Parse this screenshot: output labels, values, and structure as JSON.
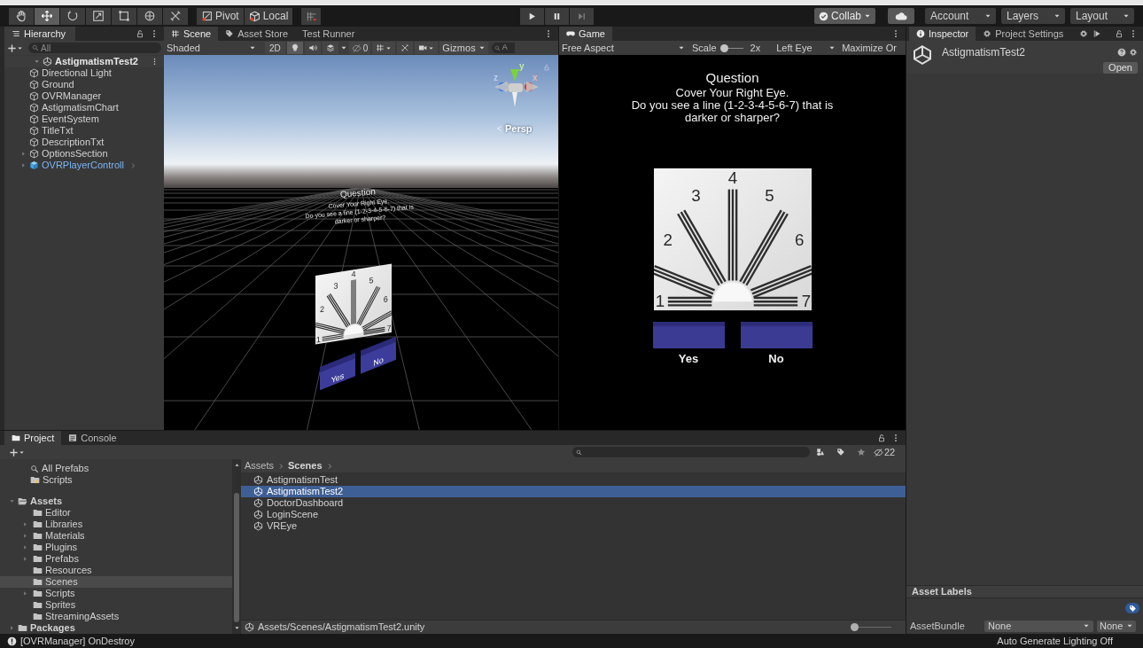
{
  "toolbar": {
    "tools": [
      {
        "kind": "hand",
        "selected": false
      },
      {
        "kind": "move",
        "selected": true
      },
      {
        "kind": "rotate",
        "selected": false
      },
      {
        "kind": "scale",
        "selected": false
      },
      {
        "kind": "rect",
        "selected": false
      },
      {
        "kind": "transform",
        "selected": false
      },
      {
        "kind": "custom",
        "selected": false
      }
    ],
    "pivot": "Pivot",
    "local": "Local",
    "collab": "Collab",
    "account": "Account",
    "layers": "Layers",
    "layout": "Layout"
  },
  "hierarchy": {
    "tab": "Hierarchy",
    "search_placeholder": "All",
    "scene": {
      "label": "AstigmatismTest2",
      "expanded": true,
      "children": [
        {
          "label": "Directional Light",
          "kind": "leaf"
        },
        {
          "label": "Ground",
          "kind": "leaf"
        },
        {
          "label": "OVRManager",
          "kind": "leaf"
        },
        {
          "label": "AstigmatismChart",
          "kind": "leaf"
        },
        {
          "label": "EventSystem",
          "kind": "leaf"
        },
        {
          "label": "TitleTxt",
          "kind": "leaf"
        },
        {
          "label": "DescriptionTxt",
          "kind": "leaf"
        },
        {
          "label": "OptionsSection",
          "kind": "branch"
        },
        {
          "label": "OVRPlayerControll",
          "kind": "prefab"
        }
      ]
    }
  },
  "scene_view": {
    "tabs": [
      {
        "label": "Scene",
        "kind": "scene",
        "selected": true
      },
      {
        "label": "Asset Store",
        "kind": "store",
        "selected": false
      },
      {
        "label": "Test Runner",
        "kind": "plain",
        "selected": false
      }
    ],
    "shading": "Shaded",
    "mode_2d": "2D",
    "hidden_count": "0",
    "gizmos": "Gizmos",
    "search_placeholder": "A",
    "axes": {
      "y": "y",
      "x": "x",
      "z": "z"
    },
    "projection": "Persp",
    "question_title": "Question",
    "question_lines": [
      "Cover Your Right Eye.",
      "Do you see a line (1-2-3-4-5-6-7) that is",
      "darker or sharper?"
    ],
    "chart_labels": [
      "1",
      "2",
      "3",
      "4",
      "5",
      "6",
      "7"
    ],
    "answers": [
      "Yes",
      "No"
    ]
  },
  "game_view": {
    "tab": "Game",
    "aspect": "Free Aspect",
    "scale_label": "Scale",
    "scale_slider": {
      "level": 0
    },
    "scale_value": "2x",
    "eye": "Left Eye",
    "maximize": "Maximize Or",
    "question_title": "Question",
    "question_lines": [
      "Cover Your Right Eye.",
      "Do you see a line (1-2-3-4-5-6-7) that is",
      "darker or sharper?"
    ],
    "chart_labels": [
      "1",
      "2",
      "3",
      "4",
      "5",
      "6",
      "7"
    ],
    "answers": [
      "Yes",
      "No"
    ]
  },
  "inspector": {
    "tabs": [
      {
        "label": "Inspector",
        "kind": "info",
        "selected": true
      },
      {
        "label": "Project Settings",
        "kind": "gear",
        "selected": false
      }
    ],
    "asset_name": "AstigmatismTest2",
    "open_button": "Open",
    "labels_header": "Asset Labels",
    "bundle_label": "AssetBundle",
    "bundle_value": "None",
    "variant_value": "None"
  },
  "project": {
    "tabs": [
      {
        "label": "Project",
        "kind": "folder",
        "selected": true
      },
      {
        "label": "Console",
        "kind": "console",
        "selected": false
      }
    ],
    "hidden_count": "22",
    "favorites": [
      {
        "label": "All Prefabs",
        "kind": "search"
      },
      {
        "label": "Scripts",
        "kind": "star-folder"
      }
    ],
    "assets": {
      "label": "Assets",
      "expanded": true,
      "children": [
        {
          "label": "Editor",
          "kind": "leaf",
          "selected": false
        },
        {
          "label": "Libraries",
          "kind": "branch",
          "selected": false
        },
        {
          "label": "Materials",
          "kind": "branch",
          "selected": false
        },
        {
          "label": "Plugins",
          "kind": "branch",
          "selected": false
        },
        {
          "label": "Prefabs",
          "kind": "branch",
          "selected": false
        },
        {
          "label": "Resources",
          "kind": "leaf",
          "selected": false
        },
        {
          "label": "Scenes",
          "kind": "leaf",
          "selected": true
        },
        {
          "label": "Scripts",
          "kind": "branch",
          "selected": false
        },
        {
          "label": "Sprites",
          "kind": "leaf",
          "selected": false
        },
        {
          "label": "StreamingAssets",
          "kind": "leaf",
          "selected": false
        }
      ]
    },
    "packages": {
      "label": "Packages",
      "expanded": false
    },
    "breadcrumb": [
      "Assets",
      "Scenes"
    ],
    "files": [
      {
        "label": "AstigmatismTest",
        "selected": false
      },
      {
        "label": "AstigmatismTest2",
        "selected": true
      },
      {
        "label": "DoctorDashboard",
        "selected": false
      },
      {
        "label": "LoginScene",
        "selected": false
      },
      {
        "label": "VREye",
        "selected": false
      }
    ],
    "path": "Assets/Scenes/AstigmatismTest2.unity",
    "zoom_slider": {
      "level": 0
    }
  },
  "status_bar": {
    "message": "[OVRManager] OnDestroy",
    "lighting": "Auto Generate Lighting Off"
  }
}
